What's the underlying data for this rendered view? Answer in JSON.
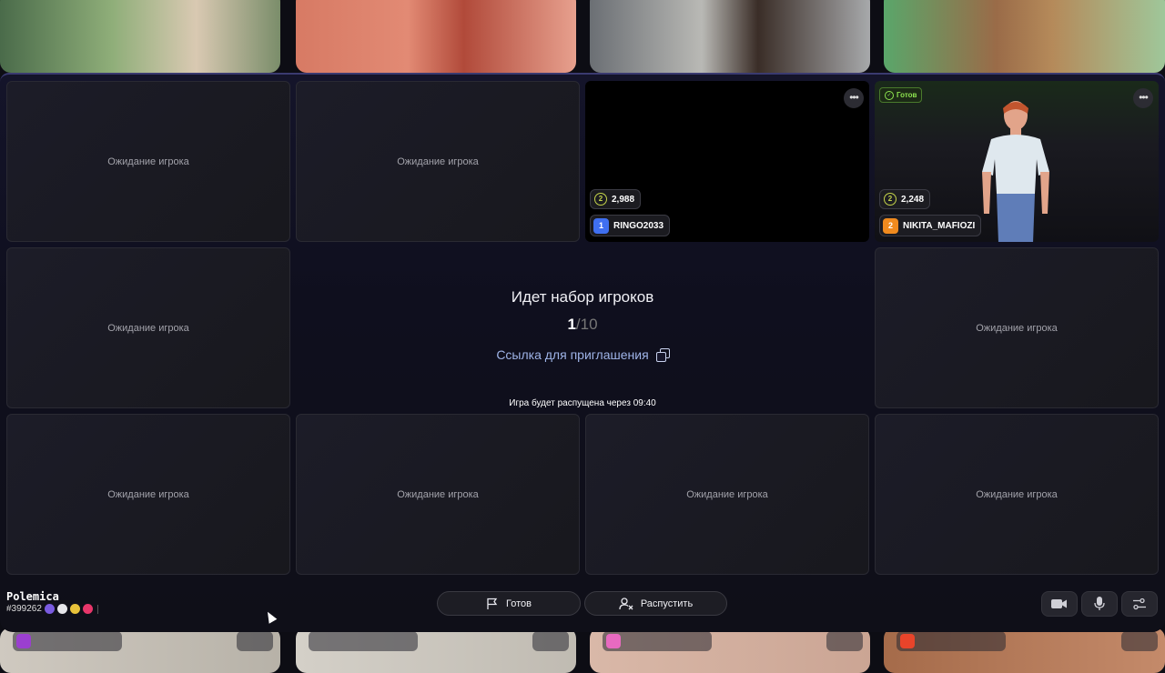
{
  "waiting_label": "Ожидание игрока",
  "players": [
    {
      "number": "1",
      "name": "RINGO2033",
      "score": "2,988",
      "coin": "2"
    },
    {
      "number": "2",
      "name": "NIKITA_MAFIOZI",
      "score": "2,248",
      "coin": "2",
      "ready_badge": "Готов"
    }
  ],
  "center": {
    "title": "Идет набор игроков",
    "count_current": "1",
    "count_total": "/10",
    "invite_link": "Ссылка для приглашения",
    "timer_text": "Игра будет распущена через 09:40"
  },
  "brand": {
    "name": "Polemica",
    "game_id": "#399262"
  },
  "buttons": {
    "ready": "Готов",
    "dismiss": "Распустить"
  },
  "icons": [
    "flag-icon",
    "user-remove-icon",
    "camera-icon",
    "microphone-icon",
    "settings-icon",
    "copy-icon",
    "more-icon"
  ],
  "colors": {
    "accent_green": "#8de34f",
    "player1": "#3f6ff0",
    "player2": "#f08a1e",
    "link": "#9fb4e8"
  }
}
